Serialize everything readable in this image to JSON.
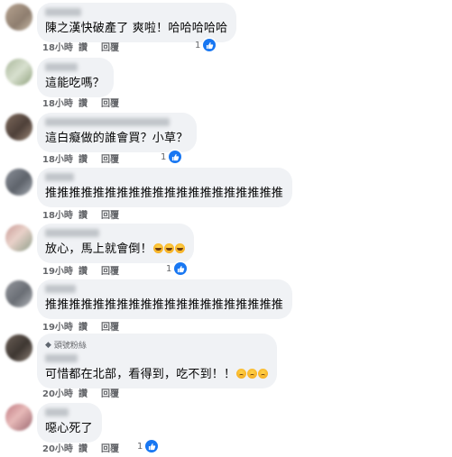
{
  "labels": {
    "like": "讚",
    "reply": "回覆"
  },
  "comments": [
    {
      "text": "陳之漢快破產了 爽啦！哈哈哈哈哈",
      "time": "18小時",
      "reactions": "1"
    },
    {
      "text": "這能吃嗎？",
      "time": "18小時"
    },
    {
      "text": "這白癡做的誰會買？小草？",
      "time": "18小時",
      "reactions": "1"
    },
    {
      "text": "推推推推推推推推推推推推推推推推推推推推",
      "time": "18小時"
    },
    {
      "text": "放心，馬上就會倒！",
      "time": "19小時",
      "reactions": "1",
      "emojis": [
        "laughing-tears",
        "laughing-tears",
        "laughing-tears"
      ]
    },
    {
      "text": "推推推推推推推推推推推推推推推推推推推推",
      "time": "19小時"
    },
    {
      "badge": "頭號粉絲",
      "text": "可惜都在北部，看得到，吃不到！！",
      "time": "20小時",
      "emojis": [
        "sad-face",
        "sad-face",
        "sad-face"
      ]
    },
    {
      "text": "噁心死了",
      "time": "20小時",
      "reactions": "1"
    }
  ],
  "colors": {
    "like_blue": "#1877f2",
    "bubble": "#f0f2f5",
    "meta_gray": "#65676b"
  }
}
